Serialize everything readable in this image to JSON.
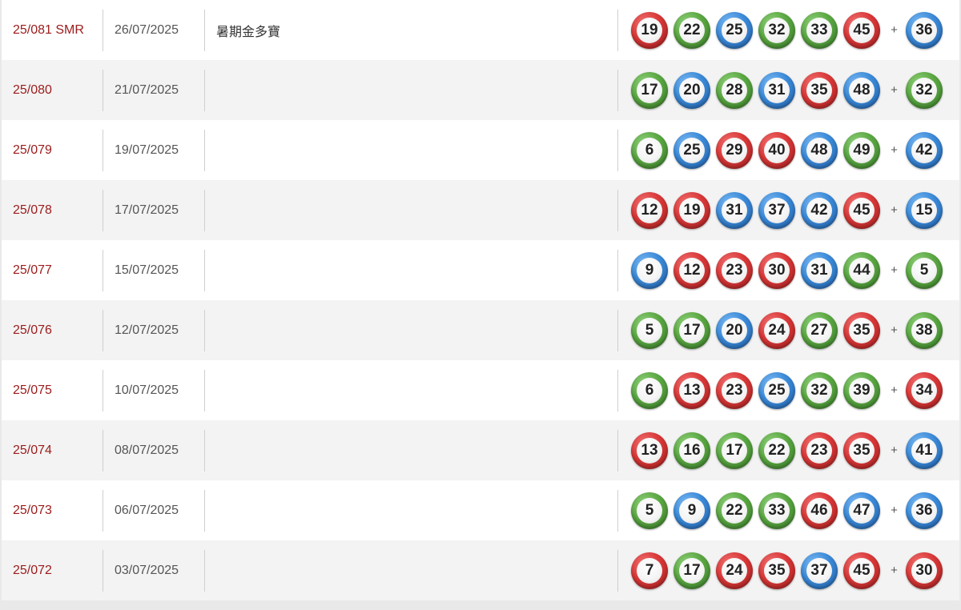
{
  "colors": {
    "red": "#d93838",
    "green": "#5aa742",
    "blue": "#3b8ad8",
    "draw_link": "#9b1b1b"
  },
  "plus_sign": "+",
  "rows": [
    {
      "draw": "25/081 SMR",
      "date": "26/07/2025",
      "note": "暑期金多寶",
      "numbers": [
        {
          "n": "19",
          "c": "red"
        },
        {
          "n": "22",
          "c": "green"
        },
        {
          "n": "25",
          "c": "blue"
        },
        {
          "n": "32",
          "c": "green"
        },
        {
          "n": "33",
          "c": "green"
        },
        {
          "n": "45",
          "c": "red"
        }
      ],
      "extra": {
        "n": "36",
        "c": "blue"
      }
    },
    {
      "draw": "25/080",
      "date": "21/07/2025",
      "note": "",
      "numbers": [
        {
          "n": "17",
          "c": "green"
        },
        {
          "n": "20",
          "c": "blue"
        },
        {
          "n": "28",
          "c": "green"
        },
        {
          "n": "31",
          "c": "blue"
        },
        {
          "n": "35",
          "c": "red"
        },
        {
          "n": "48",
          "c": "blue"
        }
      ],
      "extra": {
        "n": "32",
        "c": "green"
      }
    },
    {
      "draw": "25/079",
      "date": "19/07/2025",
      "note": "",
      "numbers": [
        {
          "n": "6",
          "c": "green"
        },
        {
          "n": "25",
          "c": "blue"
        },
        {
          "n": "29",
          "c": "red"
        },
        {
          "n": "40",
          "c": "red"
        },
        {
          "n": "48",
          "c": "blue"
        },
        {
          "n": "49",
          "c": "green"
        }
      ],
      "extra": {
        "n": "42",
        "c": "blue"
      }
    },
    {
      "draw": "25/078",
      "date": "17/07/2025",
      "note": "",
      "numbers": [
        {
          "n": "12",
          "c": "red"
        },
        {
          "n": "19",
          "c": "red"
        },
        {
          "n": "31",
          "c": "blue"
        },
        {
          "n": "37",
          "c": "blue"
        },
        {
          "n": "42",
          "c": "blue"
        },
        {
          "n": "45",
          "c": "red"
        }
      ],
      "extra": {
        "n": "15",
        "c": "blue"
      }
    },
    {
      "draw": "25/077",
      "date": "15/07/2025",
      "note": "",
      "numbers": [
        {
          "n": "9",
          "c": "blue"
        },
        {
          "n": "12",
          "c": "red"
        },
        {
          "n": "23",
          "c": "red"
        },
        {
          "n": "30",
          "c": "red"
        },
        {
          "n": "31",
          "c": "blue"
        },
        {
          "n": "44",
          "c": "green"
        }
      ],
      "extra": {
        "n": "5",
        "c": "green"
      }
    },
    {
      "draw": "25/076",
      "date": "12/07/2025",
      "note": "",
      "numbers": [
        {
          "n": "5",
          "c": "green"
        },
        {
          "n": "17",
          "c": "green"
        },
        {
          "n": "20",
          "c": "blue"
        },
        {
          "n": "24",
          "c": "red"
        },
        {
          "n": "27",
          "c": "green"
        },
        {
          "n": "35",
          "c": "red"
        }
      ],
      "extra": {
        "n": "38",
        "c": "green"
      }
    },
    {
      "draw": "25/075",
      "date": "10/07/2025",
      "note": "",
      "numbers": [
        {
          "n": "6",
          "c": "green"
        },
        {
          "n": "13",
          "c": "red"
        },
        {
          "n": "23",
          "c": "red"
        },
        {
          "n": "25",
          "c": "blue"
        },
        {
          "n": "32",
          "c": "green"
        },
        {
          "n": "39",
          "c": "green"
        }
      ],
      "extra": {
        "n": "34",
        "c": "red"
      }
    },
    {
      "draw": "25/074",
      "date": "08/07/2025",
      "note": "",
      "numbers": [
        {
          "n": "13",
          "c": "red"
        },
        {
          "n": "16",
          "c": "green"
        },
        {
          "n": "17",
          "c": "green"
        },
        {
          "n": "22",
          "c": "green"
        },
        {
          "n": "23",
          "c": "red"
        },
        {
          "n": "35",
          "c": "red"
        }
      ],
      "extra": {
        "n": "41",
        "c": "blue"
      }
    },
    {
      "draw": "25/073",
      "date": "06/07/2025",
      "note": "",
      "numbers": [
        {
          "n": "5",
          "c": "green"
        },
        {
          "n": "9",
          "c": "blue"
        },
        {
          "n": "22",
          "c": "green"
        },
        {
          "n": "33",
          "c": "green"
        },
        {
          "n": "46",
          "c": "red"
        },
        {
          "n": "47",
          "c": "blue"
        }
      ],
      "extra": {
        "n": "36",
        "c": "blue"
      }
    },
    {
      "draw": "25/072",
      "date": "03/07/2025",
      "note": "",
      "numbers": [
        {
          "n": "7",
          "c": "red"
        },
        {
          "n": "17",
          "c": "green"
        },
        {
          "n": "24",
          "c": "red"
        },
        {
          "n": "35",
          "c": "red"
        },
        {
          "n": "37",
          "c": "blue"
        },
        {
          "n": "45",
          "c": "red"
        }
      ],
      "extra": {
        "n": "30",
        "c": "red"
      }
    }
  ]
}
